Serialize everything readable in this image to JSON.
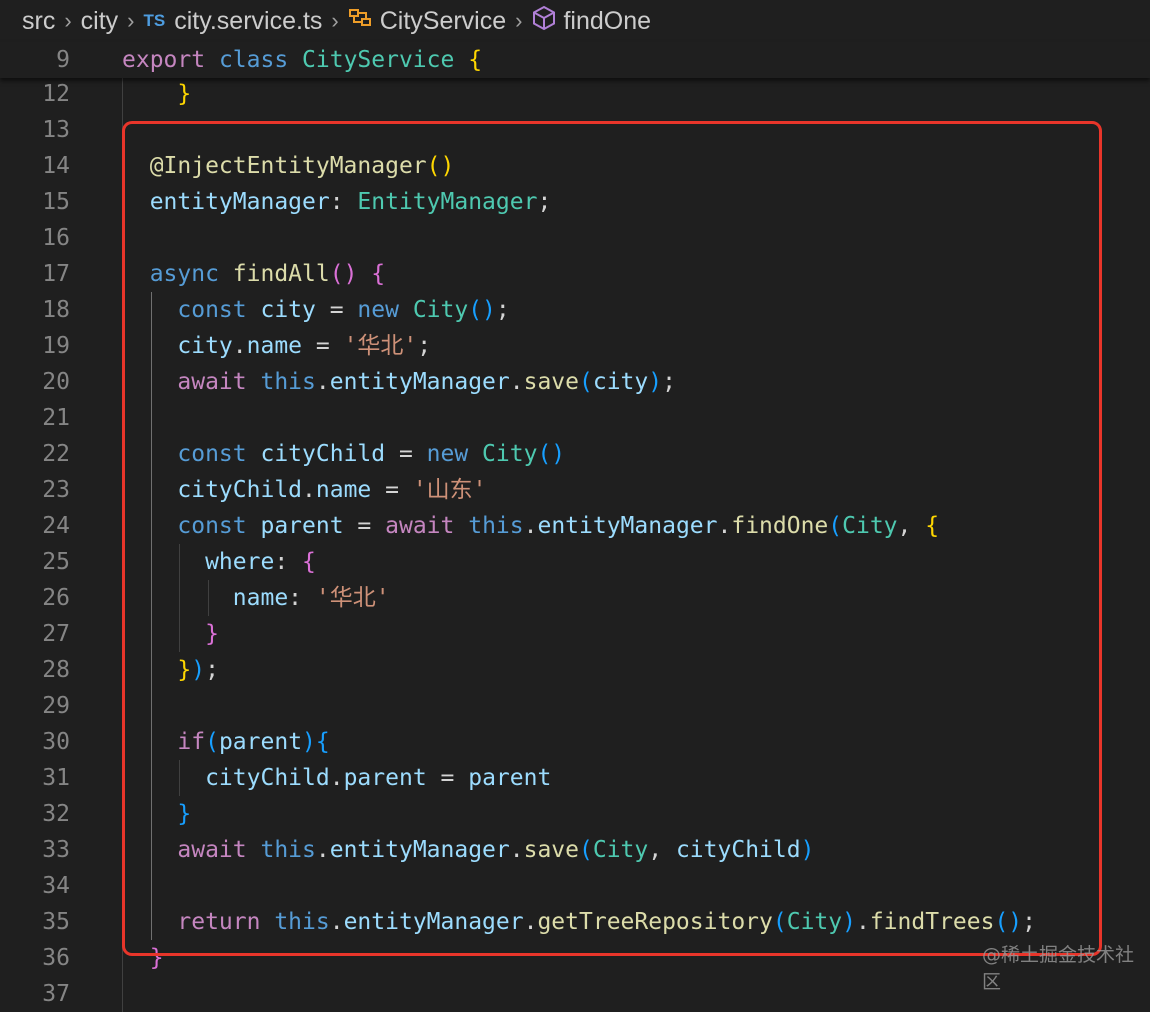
{
  "breadcrumb": {
    "items": [
      {
        "text": "src",
        "icon": ""
      },
      {
        "text": "city",
        "icon": ""
      },
      {
        "text": "city.service.ts",
        "icon": "typescript-file-icon",
        "icon_text": "TS"
      },
      {
        "text": "CityService",
        "icon": "class-icon"
      },
      {
        "text": "findOne",
        "icon": "method-cube-icon"
      }
    ],
    "separator": "›"
  },
  "colors": {
    "background": "#1f1f1f",
    "keyword_control": "#c586c0",
    "keyword_storage": "#569cd6",
    "type": "#4ec9b0",
    "function": "#dcdcaa",
    "variable": "#9cdcfe",
    "string": "#ce9178",
    "bracket_gold": "#ffd700",
    "bracket_purple": "#da70d6",
    "bracket_blue": "#179fff",
    "highlight_box": "#e8352a"
  },
  "editor": {
    "sticky_line": {
      "number": "9",
      "tokens": [
        [
          "export ",
          "kw"
        ],
        [
          "class ",
          "st"
        ],
        [
          "CityService ",
          "ty"
        ],
        [
          "{",
          "b1"
        ]
      ]
    },
    "lines": [
      {
        "number": "12",
        "tokens": [
          [
            "    }",
            "b1"
          ]
        ]
      },
      {
        "number": "13",
        "tokens": []
      },
      {
        "number": "14",
        "tokens": [
          [
            "  @InjectEntityManager",
            "fn"
          ],
          [
            "()",
            "b1"
          ]
        ]
      },
      {
        "number": "15",
        "tokens": [
          [
            "  entityManager",
            "vr"
          ],
          [
            ": ",
            "pl"
          ],
          [
            "EntityManager",
            "ty"
          ],
          [
            ";",
            "pl"
          ]
        ]
      },
      {
        "number": "16",
        "tokens": []
      },
      {
        "number": "17",
        "tokens": [
          [
            "  async ",
            "st"
          ],
          [
            "findAll",
            "fn"
          ],
          [
            "() ",
            "b2"
          ],
          [
            "{",
            "b2"
          ]
        ]
      },
      {
        "number": "18",
        "tokens": [
          [
            "    const ",
            "st"
          ],
          [
            "city",
            "vr"
          ],
          [
            " = ",
            "pl"
          ],
          [
            "new ",
            "st"
          ],
          [
            "City",
            "ty"
          ],
          [
            "()",
            "b3"
          ],
          [
            ";",
            "pl"
          ]
        ]
      },
      {
        "number": "19",
        "tokens": [
          [
            "    city",
            "vr"
          ],
          [
            ".",
            "pl"
          ],
          [
            "name",
            "vr"
          ],
          [
            " = ",
            "pl"
          ],
          [
            "'华北'",
            "sg"
          ],
          [
            ";",
            "pl"
          ]
        ]
      },
      {
        "number": "20",
        "tokens": [
          [
            "    await ",
            "kw"
          ],
          [
            "this",
            "st"
          ],
          [
            ".",
            "pl"
          ],
          [
            "entityManager",
            "vr"
          ],
          [
            ".",
            "pl"
          ],
          [
            "save",
            "fn"
          ],
          [
            "(",
            "b3"
          ],
          [
            "city",
            "vr"
          ],
          [
            ")",
            "b3"
          ],
          [
            ";",
            "pl"
          ]
        ]
      },
      {
        "number": "21",
        "tokens": []
      },
      {
        "number": "22",
        "tokens": [
          [
            "    const ",
            "st"
          ],
          [
            "cityChild",
            "vr"
          ],
          [
            " = ",
            "pl"
          ],
          [
            "new ",
            "st"
          ],
          [
            "City",
            "ty"
          ],
          [
            "()",
            "b3"
          ]
        ]
      },
      {
        "number": "23",
        "tokens": [
          [
            "    cityChild",
            "vr"
          ],
          [
            ".",
            "pl"
          ],
          [
            "name",
            "vr"
          ],
          [
            " = ",
            "pl"
          ],
          [
            "'山东'",
            "sg"
          ]
        ]
      },
      {
        "number": "24",
        "tokens": [
          [
            "    const ",
            "st"
          ],
          [
            "parent",
            "vr"
          ],
          [
            " = ",
            "pl"
          ],
          [
            "await ",
            "kw"
          ],
          [
            "this",
            "st"
          ],
          [
            ".",
            "pl"
          ],
          [
            "entityManager",
            "vr"
          ],
          [
            ".",
            "pl"
          ],
          [
            "findOne",
            "fn"
          ],
          [
            "(",
            "b3"
          ],
          [
            "City",
            "ty"
          ],
          [
            ", ",
            "pl"
          ],
          [
            "{",
            "b1"
          ]
        ]
      },
      {
        "number": "25",
        "tokens": [
          [
            "      where",
            "vr"
          ],
          [
            ": ",
            "pl"
          ],
          [
            "{",
            "b2"
          ]
        ]
      },
      {
        "number": "26",
        "tokens": [
          [
            "        name",
            "vr"
          ],
          [
            ": ",
            "pl"
          ],
          [
            "'华北'",
            "sg"
          ]
        ]
      },
      {
        "number": "27",
        "tokens": [
          [
            "      }",
            "b2"
          ]
        ]
      },
      {
        "number": "28",
        "tokens": [
          [
            "    }",
            "b1"
          ],
          [
            ")",
            "b3"
          ],
          [
            ";",
            "pl"
          ]
        ]
      },
      {
        "number": "29",
        "tokens": []
      },
      {
        "number": "30",
        "tokens": [
          [
            "    if",
            "kw"
          ],
          [
            "(",
            "b3"
          ],
          [
            "parent",
            "vr"
          ],
          [
            ")",
            "b3"
          ],
          [
            "{",
            "b3"
          ]
        ]
      },
      {
        "number": "31",
        "tokens": [
          [
            "      cityChild",
            "vr"
          ],
          [
            ".",
            "pl"
          ],
          [
            "parent",
            "vr"
          ],
          [
            " = ",
            "pl"
          ],
          [
            "parent",
            "vr"
          ]
        ]
      },
      {
        "number": "32",
        "tokens": [
          [
            "    }",
            "b3"
          ]
        ]
      },
      {
        "number": "33",
        "tokens": [
          [
            "    await ",
            "kw"
          ],
          [
            "this",
            "st"
          ],
          [
            ".",
            "pl"
          ],
          [
            "entityManager",
            "vr"
          ],
          [
            ".",
            "pl"
          ],
          [
            "save",
            "fn"
          ],
          [
            "(",
            "b3"
          ],
          [
            "City",
            "ty"
          ],
          [
            ", ",
            "pl"
          ],
          [
            "cityChild",
            "vr"
          ],
          [
            ")",
            "b3"
          ]
        ]
      },
      {
        "number": "34",
        "tokens": []
      },
      {
        "number": "35",
        "tokens": [
          [
            "    return ",
            "kw"
          ],
          [
            "this",
            "st"
          ],
          [
            ".",
            "pl"
          ],
          [
            "entityManager",
            "vr"
          ],
          [
            ".",
            "pl"
          ],
          [
            "getTreeRepository",
            "fn"
          ],
          [
            "(",
            "b3"
          ],
          [
            "City",
            "ty"
          ],
          [
            ")",
            "b3"
          ],
          [
            ".",
            "pl"
          ],
          [
            "findTrees",
            "fn"
          ],
          [
            "()",
            "b3"
          ],
          [
            ";",
            "pl"
          ]
        ]
      },
      {
        "number": "36",
        "tokens": [
          [
            "  }",
            "b2"
          ]
        ]
      },
      {
        "number": "37",
        "tokens": []
      }
    ]
  },
  "watermark": "@稀土掘金技术社区"
}
